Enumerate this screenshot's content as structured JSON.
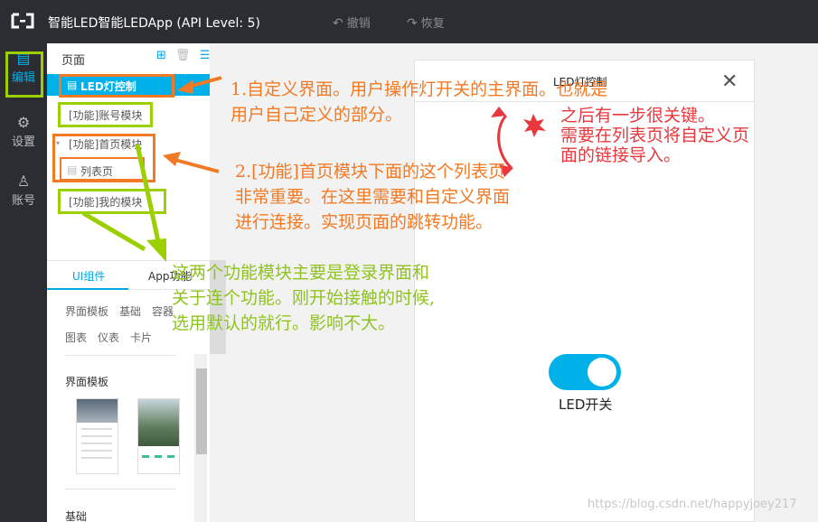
{
  "topbar": {
    "app_title": "智能LED智能LEDApp (API Level: 5)",
    "undo_label": "撤销",
    "redo_label": "恢复"
  },
  "leftnav": {
    "items": [
      {
        "label": "编辑",
        "icon": "edit-icon"
      },
      {
        "label": "设置",
        "icon": "gear-icon"
      },
      {
        "label": "账号",
        "icon": "user-icon"
      }
    ]
  },
  "pages_panel": {
    "title": "页面",
    "tree": [
      {
        "label": "LED灯控制"
      },
      {
        "label": "[功能]账号模块"
      },
      {
        "label": "[功能]首页模块"
      },
      {
        "label": "列表页"
      },
      {
        "label": "[功能]我的模块"
      }
    ]
  },
  "components_panel": {
    "tabs": [
      "UI组件",
      "App功能"
    ],
    "categories_row1": [
      "界面模板",
      "基础",
      "容器"
    ],
    "categories_row2": [
      "图表",
      "仪表",
      "卡片"
    ],
    "section_templates": "界面模板",
    "section_basic": "基础"
  },
  "phone": {
    "title": "LED灯控制",
    "toggle_label": "LED开关",
    "toggle_on": true
  },
  "annotations": {
    "note1": "1.自定义界面。用户操作灯开关的主界面。也就是\n用户自己定义的部分。",
    "note2": "2.[功能]首页模块下面的这个列表页\n非常重要。在这里需要和自定义界面\n进行连接。实现页面的跳转功能。",
    "note3": "这两个功能模块主要是登录界面和\n关于连个功能。刚开始接触的时候,\n选用默认的就行。影响不大。",
    "note4": "之后有一步很关键。\n需要在列表页将自定义页\n面的链接导入。"
  },
  "watermark": "https://blog.csdn.net/happyjoey217",
  "colors": {
    "accent": "#00b0e8",
    "annotation_orange": "#f27a25",
    "annotation_green": "#9ccf00",
    "annotation_red": "#e8383d",
    "chrome_dark": "#2b2d32"
  }
}
